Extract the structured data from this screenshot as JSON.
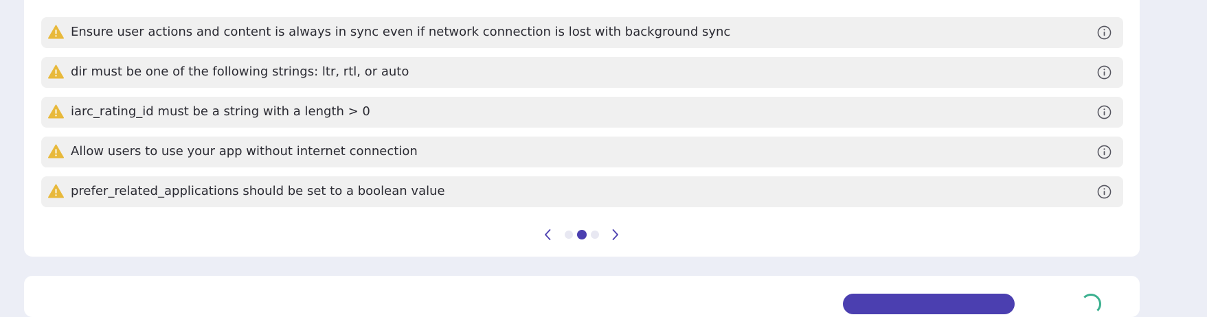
{
  "warnings": [
    {
      "text": "Ensure user actions and content is always in sync even if network connection is lost with background sync",
      "icon": "warning-triangle-icon",
      "info_icon": "info-circle-icon"
    },
    {
      "text": "dir must be one of the following strings: ltr, rtl, or auto",
      "icon": "warning-triangle-icon",
      "info_icon": "info-circle-icon"
    },
    {
      "text": "iarc_rating_id must be a string with a length > 0",
      "icon": "warning-triangle-icon",
      "info_icon": "info-circle-icon"
    },
    {
      "text": "Allow users to use your app without internet connection",
      "icon": "warning-triangle-icon",
      "info_icon": "info-circle-icon"
    },
    {
      "text": "prefer_related_applications should be set to a boolean value",
      "icon": "warning-triangle-icon",
      "info_icon": "info-circle-icon"
    }
  ],
  "pager": {
    "prev_icon": "chevron-left-icon",
    "next_icon": "chevron-right-icon",
    "total_pages": 3,
    "active_page": 2
  },
  "colors": {
    "page_bg": "#eceef6",
    "card_bg": "#ffffff",
    "row_bg": "#f0f0f0",
    "warning": "#e8b93b",
    "accent": "#4b3fb0",
    "dot_inactive": "#e8e8f2",
    "info_icon": "#55555f"
  }
}
